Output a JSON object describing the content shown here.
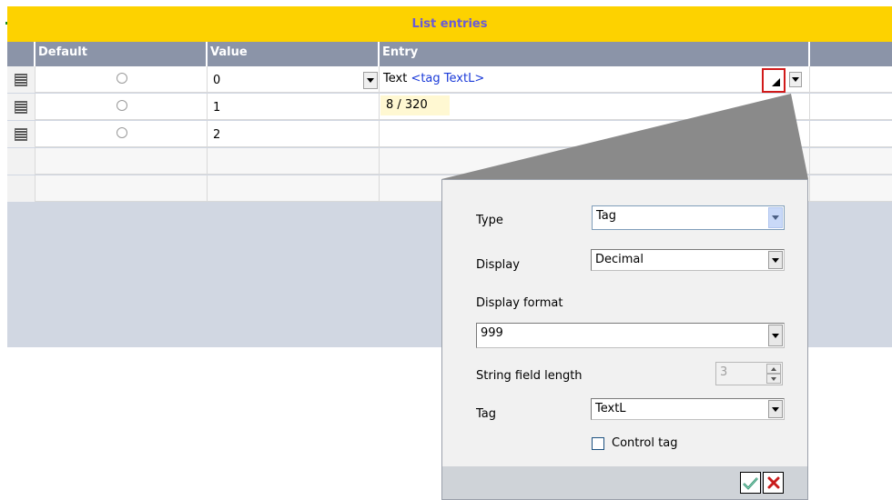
{
  "title": "List entries",
  "columns": {
    "default": "Default",
    "value": "Value",
    "entry": "Entry"
  },
  "rows": [
    {
      "value": "0",
      "entry_prefix": "Text ",
      "entry_tag": "<tag TextL>"
    },
    {
      "value": "1",
      "entry_prefix": "",
      "entry_tag": ""
    },
    {
      "value": "2",
      "entry_prefix": "",
      "entry_tag": ""
    }
  ],
  "counter": "8 / 320",
  "popup": {
    "type_label": "Type",
    "type_value": "Tag",
    "display_label": "Display",
    "display_value": "Decimal",
    "display_format_label": "Display format",
    "display_format_value": "999",
    "string_field_length_label": "String field length",
    "string_field_length_value": "3",
    "tag_label": "Tag",
    "tag_value": "TextL",
    "control_tag_label": "Control tag",
    "control_tag_checked": false
  },
  "colors": {
    "title_bg": "#fdd200",
    "title_text": "#6a5bd6",
    "header_bg": "#8b94a8",
    "grid_bg": "#d1d7e2",
    "tag_blue": "#1a3ad8",
    "highlight_red": "#d11a1a"
  },
  "icons": {
    "row_handle": "row-handle-icon",
    "expand": "expand-triangle-icon",
    "ok": "checkmark-icon",
    "cancel": "close-icon"
  }
}
